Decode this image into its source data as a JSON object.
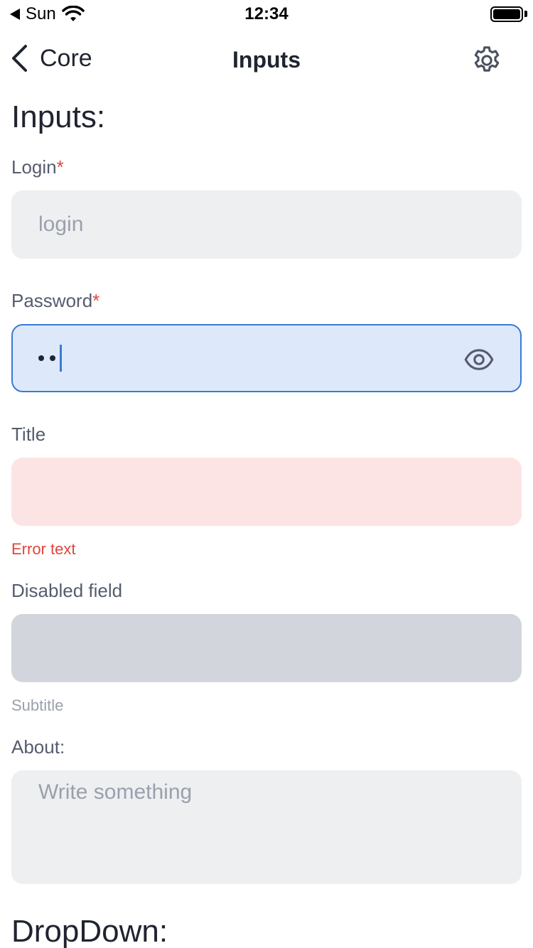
{
  "status_bar": {
    "back_app": "Sun",
    "time": "12:34"
  },
  "nav": {
    "back_label": "Core",
    "title": "Inputs",
    "settings_icon": "gear-icon"
  },
  "inputs_section": {
    "title": "Inputs:",
    "login": {
      "label": "Login",
      "required_mark": "*",
      "placeholder": "login",
      "value": ""
    },
    "password": {
      "label": "Password",
      "required_mark": "*",
      "masked_chars": 2,
      "icon": "eye-icon"
    },
    "title_field": {
      "label": "Title",
      "value": "",
      "error_text": "Error text"
    },
    "disabled_field": {
      "label": "Disabled field",
      "value": "",
      "subtitle": "Subtitle"
    },
    "about": {
      "label": "About:",
      "placeholder": "Write something"
    }
  },
  "dropdown_section": {
    "title": "DropDown:"
  },
  "colors": {
    "accent": "#3a7bd5",
    "error": "#e0463c",
    "input_bg": "#eeeff1",
    "focused_bg": "#dde9fb",
    "error_bg": "#fde4e4",
    "disabled_bg": "#d2d5dc"
  }
}
